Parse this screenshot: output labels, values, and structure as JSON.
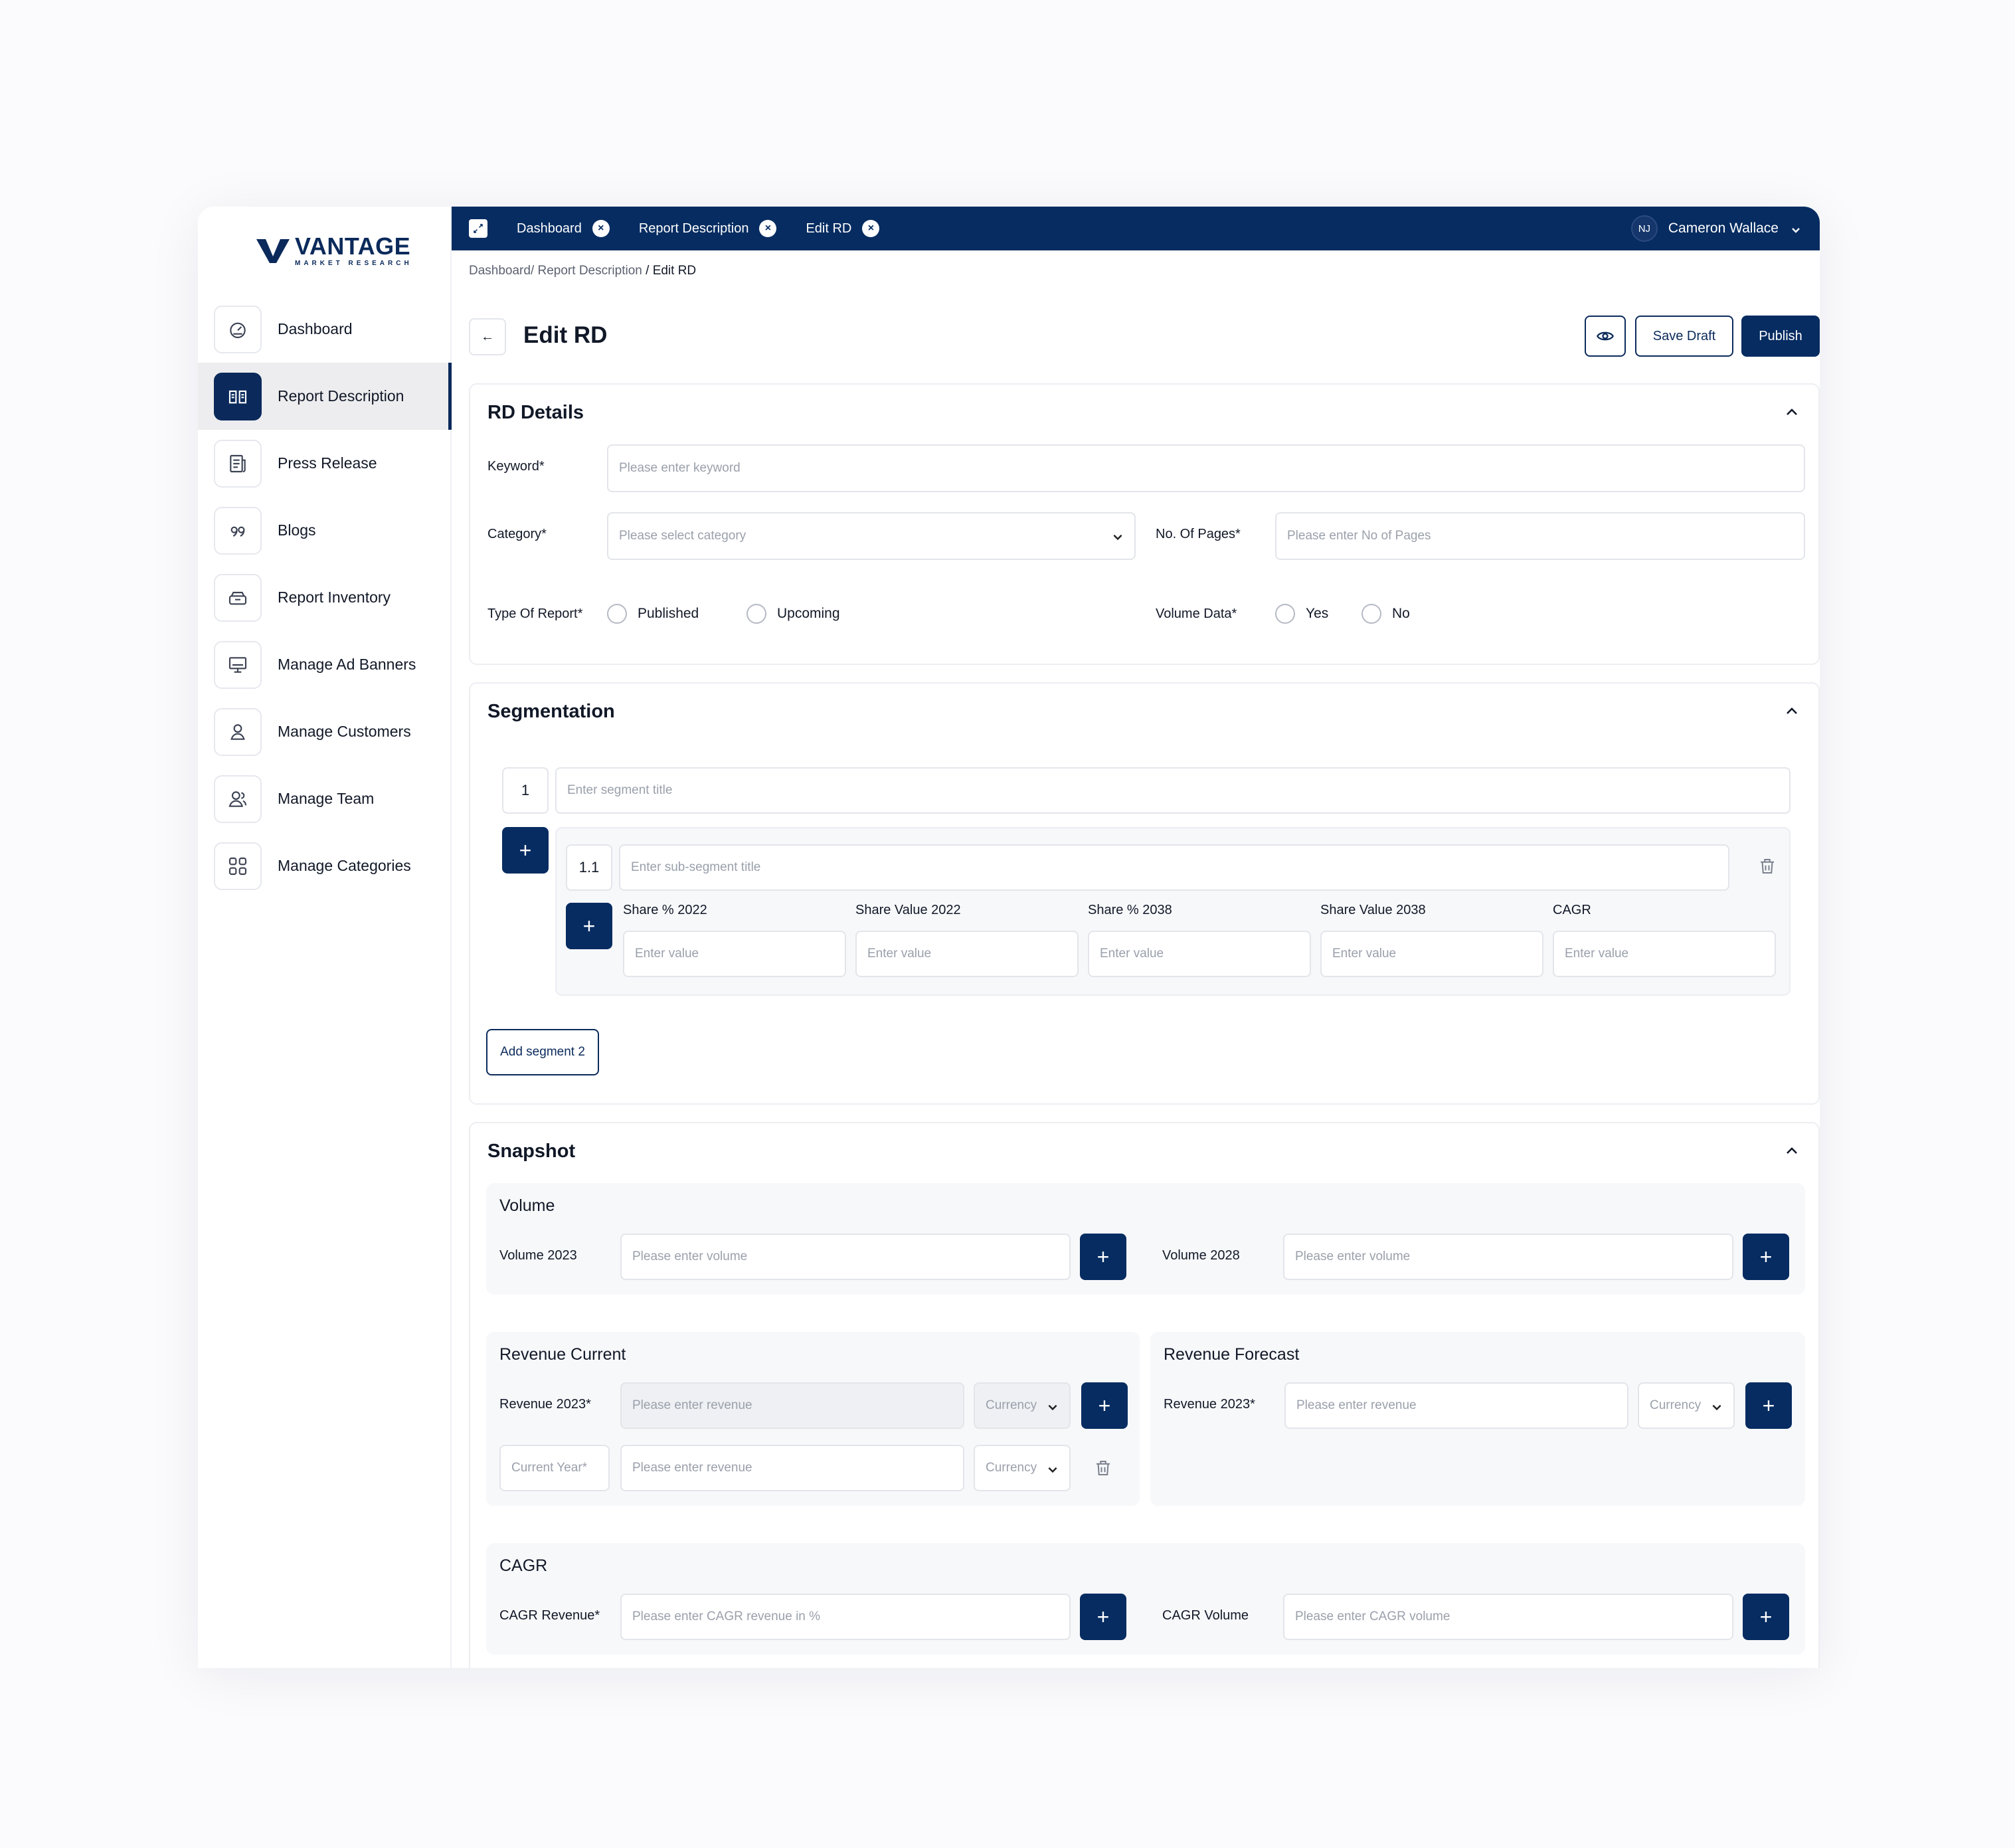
{
  "brand": {
    "name": "VANTAGE",
    "tagline": "MARKET RESEARCH"
  },
  "sidebar": {
    "items": [
      {
        "label": "Dashboard",
        "icon": "dashboard-gauge-icon",
        "active": false
      },
      {
        "label": "Report Description",
        "icon": "book-open-icon",
        "active": true
      },
      {
        "label": "Press Release",
        "icon": "newspaper-icon",
        "active": false
      },
      {
        "label": "Blogs",
        "icon": "quote-icon",
        "active": false
      },
      {
        "label": "Report Inventory",
        "icon": "inbox-stack-icon",
        "active": false
      },
      {
        "label": "Manage Ad Banners",
        "icon": "monitor-icon",
        "active": false
      },
      {
        "label": "Manage Customers",
        "icon": "user-icon",
        "active": false
      },
      {
        "label": "Manage Team",
        "icon": "team-icon",
        "active": false
      },
      {
        "label": "Manage Categories",
        "icon": "grid-icon",
        "active": false
      }
    ]
  },
  "topbar": {
    "tabs": [
      {
        "label": "Dashboard"
      },
      {
        "label": "Report Description"
      },
      {
        "label": "Edit RD"
      }
    ],
    "user": {
      "initials": "NJ",
      "name": "Cameron Wallace"
    },
    "accent": "#062c61"
  },
  "breadcrumb": {
    "path": "Dashboard/ Report Description",
    "current": " / Edit RD"
  },
  "header": {
    "title": "Edit RD",
    "back_label": "←",
    "save_label": "Save Draft",
    "publish_label": "Publish"
  },
  "rd_details": {
    "title": "RD Details",
    "keyword": {
      "label": "Keyword*",
      "placeholder": "Please enter keyword"
    },
    "category": {
      "label": "Category*",
      "placeholder": "Please select category"
    },
    "pages": {
      "label": "No. Of Pages*",
      "placeholder": "Please enter No of Pages"
    },
    "report_type": {
      "label": "Type Of Report*",
      "options": [
        "Published",
        "Upcoming"
      ]
    },
    "volume_data": {
      "label": "Volume Data*",
      "options": [
        "Yes",
        "No"
      ]
    }
  },
  "segmentation": {
    "title": "Segmentation",
    "segment_number": "1",
    "segment_placeholder": "Enter segment title",
    "sub_number": "1.1",
    "sub_placeholder": "Enter sub-segment title",
    "columns": [
      "Share % 2022",
      "Share Value 2022",
      "Share % 2038",
      "Share Value 2038",
      "CAGR"
    ],
    "value_placeholder": "Enter value",
    "add_segment_label": "Add segment 2",
    "plus_label": "+"
  },
  "snapshot": {
    "title": "Snapshot",
    "volume": {
      "title": "Volume",
      "left": {
        "label": "Volume 2023",
        "placeholder": "Please enter volume"
      },
      "right": {
        "label": "Volume 2028",
        "placeholder": "Please enter volume"
      }
    },
    "revenue_current": {
      "title": "Revenue Current",
      "row1": {
        "label": "Revenue 2023*",
        "placeholder": "Please enter revenue",
        "currency": "Currency"
      },
      "row2": {
        "year_placeholder": "Current Year*",
        "placeholder": "Please enter revenue",
        "currency": "Currency"
      }
    },
    "revenue_forecast": {
      "title": "Revenue Forecast",
      "row1": {
        "label": "Revenue 2023*",
        "placeholder": "Please enter revenue",
        "currency": "Currency"
      }
    },
    "cagr": {
      "title": "CAGR",
      "left": {
        "label": "CAGR Revenue*",
        "placeholder": "Please enter CAGR revenue in %"
      },
      "right": {
        "label": "CAGR Volume",
        "placeholder": "Please enter CAGR volume"
      }
    }
  }
}
